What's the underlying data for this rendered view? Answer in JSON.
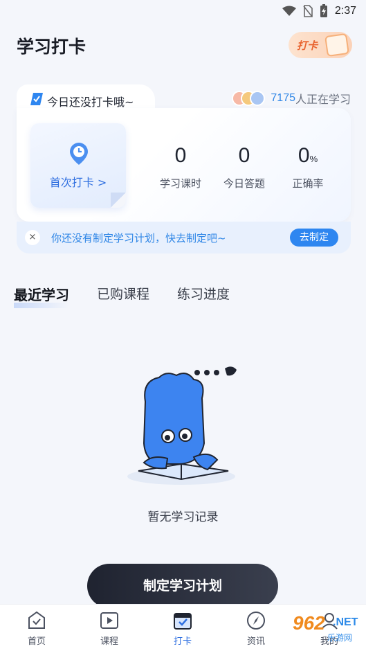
{
  "status_bar": {
    "time": "2:37"
  },
  "header": {
    "title": "学习打卡",
    "checkin_badge": "打卡"
  },
  "card": {
    "tab_text": "今日还没打卡哦~",
    "learner_count": "7175",
    "learner_text": "人正在学习",
    "first_checkin": "首次打卡 >",
    "stats": [
      {
        "value": "0",
        "unit": "",
        "label": "学习课时"
      },
      {
        "value": "0",
        "unit": "",
        "label": "今日答题"
      },
      {
        "value": "0",
        "unit": "%",
        "label": "正确率"
      }
    ]
  },
  "plan_bar": {
    "close": "×",
    "text": "你还没有制定学习计划，快去制定吧~",
    "button": "去制定"
  },
  "tabs": [
    {
      "label": "最近学习",
      "active": true
    },
    {
      "label": "已购课程",
      "active": false
    },
    {
      "label": "练习进度",
      "active": false
    }
  ],
  "empty": {
    "text": "暂无学习记录"
  },
  "cta": {
    "label": "制定学习计划"
  },
  "bottom_nav": [
    {
      "label": "首页",
      "icon": "home-icon"
    },
    {
      "label": "课程",
      "icon": "play-icon"
    },
    {
      "label": "打卡",
      "icon": "calendar-check-icon",
      "active": true
    },
    {
      "label": "资讯",
      "icon": "compass-icon"
    },
    {
      "label": "我的",
      "icon": "user-icon"
    }
  ],
  "watermark": {
    "number": "962",
    "net": ".NET",
    "sub": "乐游网"
  },
  "colors": {
    "accent": "#2e86f0",
    "cta_dark": "#1f2330",
    "badge_orange": "#e8622d"
  }
}
